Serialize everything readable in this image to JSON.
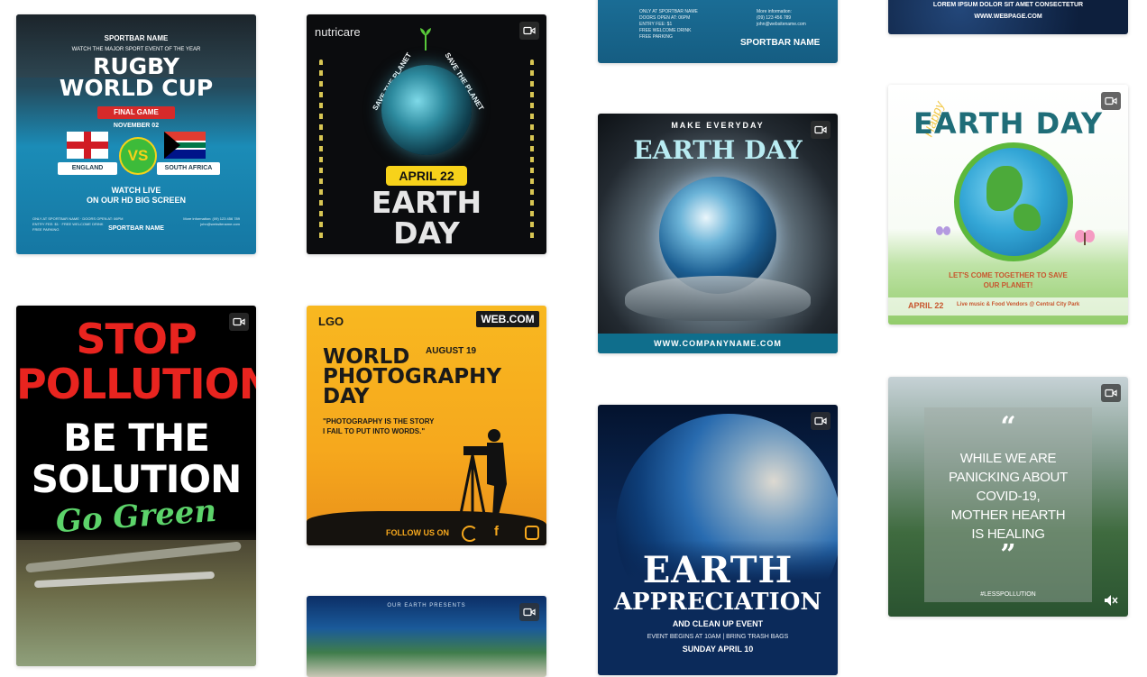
{
  "cards": {
    "rugby": {
      "sportbar_name": "SPORTBAR NAME",
      "tagline": "WATCH THE MAJOR SPORT EVENT OF THE YEAR",
      "title": "RUGBY\nWORLD CUP",
      "final_game": "FINAL GAME",
      "date": "NOVEMBER 02",
      "vs": "VS",
      "team_left": "ENGLAND",
      "team_right": "SOUTH AFRICA",
      "watch_live": "WATCH LIVE\nON OUR HD BIG SCREEN",
      "footer_left": "ONLY AT SPORTBAR NAME · DOORS OPEN AT: 06PM\nENTRY FEE: $1 · FREE WELCOME DRINK\nFREE PARKING",
      "footer_right": "More information: (09) 123 456 789\njohn@websitename.com",
      "footer_name": "SPORTBAR NAME"
    },
    "earth_nutricare": {
      "brand": "nutricare",
      "arc_left": "SAVE THE PLANET",
      "arc_right": "SAVE THE PLANET",
      "date": "APRIL 22",
      "title": "EARTH\nDAY"
    },
    "sportbar_partial": {
      "left_text": "ONLY AT SPORTBAR NAME\nDOORS OPEN AT: 06PM\nENTRY FEE: $1\nFREE WELCOME DRINK\nFREE PARKING",
      "right_text": "More information:\n(09) 123 456 789\njohn@websitename.com",
      "name": "SPORTBAR NAME"
    },
    "lorem_partial": {
      "line1": "LOREM IPSUM DOLOR SIT AMET CONSECTETUR",
      "line2": "WWW.WEBPAGE.COM"
    },
    "earth_hands": {
      "top": "MAKE EVERYDAY",
      "title": "EARTH DAY",
      "url": "WWW.COMPANYNAME.COM"
    },
    "earth_happy": {
      "happy": "Happy",
      "title": "EARTH DAY",
      "slogan": "LET'S COME TOGETHER TO SAVE\nOUR PLANET!",
      "date": "APRIL 22",
      "details": "Live music & Food Vendors @ Central City Park"
    },
    "pollution": {
      "line1": "STOP\nPOLLUTION",
      "line2": "BE THE\nSOLUTION",
      "line3": "Go Green"
    },
    "photography": {
      "logo": "LGO",
      "web": "WEB.COM",
      "date": "AUGUST 19",
      "title": "WORLD\nPHOTOGRAPHY\nDAY",
      "quote": "\"PHOTOGRAPHY IS THE STORY\nI FAIL TO PUT INTO WORDS.\"",
      "follow": "FOLLOW US ON"
    },
    "earth_appreciation": {
      "title1": "EARTH",
      "title2": "APPRECIATION",
      "subtitle": "AND CLEAN UP EVENT",
      "details": "EVENT BEGINS AT 10AM  |  BRING TRASH BAGS",
      "date": "SUNDAY APRIL 10"
    },
    "quote_forest": {
      "open_quote": "“",
      "quote": "WHILE WE ARE\nPANICKING ABOUT\nCOVID-19,\nMOTHER HEARTH\nIS HEALING",
      "close_quote": "”",
      "hashtag": "#LESSPOLLUTION"
    },
    "our_earth_partial": {
      "top": "OUR EARTH PRESENTS"
    }
  },
  "icons": {
    "video": "video-camera-icon",
    "mute": "speaker-muted-icon"
  },
  "colors": {
    "accent_yellow": "#f7d21a",
    "rugby_blue": "#1d8fb8",
    "pollution_red": "#e8241f",
    "go_green": "#5cd36a",
    "photo_orange": "#f6a81d"
  }
}
